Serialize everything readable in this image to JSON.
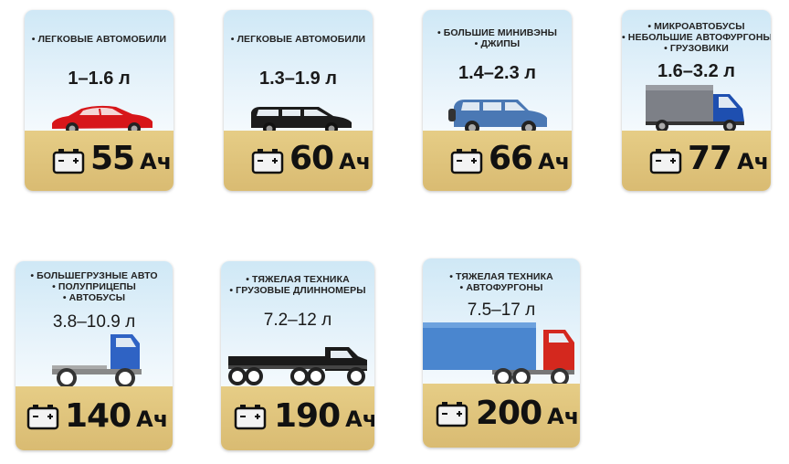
{
  "cards": [
    {
      "labels": [
        "• ЛЕГКОВЫЕ АВТОМОБИЛИ"
      ],
      "volume": "1–1.6 л",
      "capacity_value": "55",
      "capacity_unit": "Ач",
      "vehicle_icon": "sedan-car-icon",
      "vehicle_color": "#d7161a"
    },
    {
      "labels": [
        "• ЛЕГКОВЫЕ АВТОМОБИЛИ"
      ],
      "volume": "1.3–1.9 л",
      "capacity_value": "60",
      "capacity_unit": "Ач",
      "vehicle_icon": "station-wagon-icon",
      "vehicle_color": "#1c1c1c"
    },
    {
      "labels": [
        "• БОЛЬШИЕ МИНИВЭНЫ",
        "• ДЖИПЫ"
      ],
      "volume": "1.4–2.3 л",
      "capacity_value": "66",
      "capacity_unit": "Ач",
      "vehicle_icon": "suv-icon",
      "vehicle_color": "#4a78b4"
    },
    {
      "labels": [
        "• МИКРОАВТОБУСЫ",
        "• НЕБОЛЬШИЕ АВТОФУРГОНЫ",
        "• ГРУЗОВИКИ"
      ],
      "volume": "1.6–3.2 л",
      "capacity_value": "77",
      "capacity_unit": "Ач",
      "vehicle_icon": "van-truck-icon",
      "vehicle_color": "#1e4fb0"
    },
    {
      "labels": [
        "• БОЛЬШЕГРУЗНЫЕ АВТО",
        "• ПОЛУПРИЦЕПЫ",
        "• АВТОБУСЫ"
      ],
      "volume": "3.8–10.9 л",
      "capacity_value": "140",
      "capacity_unit": "Ач",
      "vehicle_icon": "tractor-unit-icon",
      "vehicle_color": "#2f63c4"
    },
    {
      "labels": [
        "• ТЯЖЕЛАЯ ТЕХНИКА",
        "• ГРУЗОВЫЕ ДЛИННОМЕРЫ"
      ],
      "volume": "7.2–12 л",
      "capacity_value": "190",
      "capacity_unit": "Ач",
      "vehicle_icon": "flatbed-truck-icon",
      "vehicle_color": "#1a1a1a"
    },
    {
      "labels": [
        "• ТЯЖЕЛАЯ ТЕХНИКА",
        "• АВТОФУРГОНЫ"
      ],
      "volume": "7.5–17 л",
      "capacity_value": "200",
      "capacity_unit": "Ач",
      "vehicle_icon": "semi-trailer-truck-icon",
      "vehicle_color": "#d4281e"
    }
  ]
}
